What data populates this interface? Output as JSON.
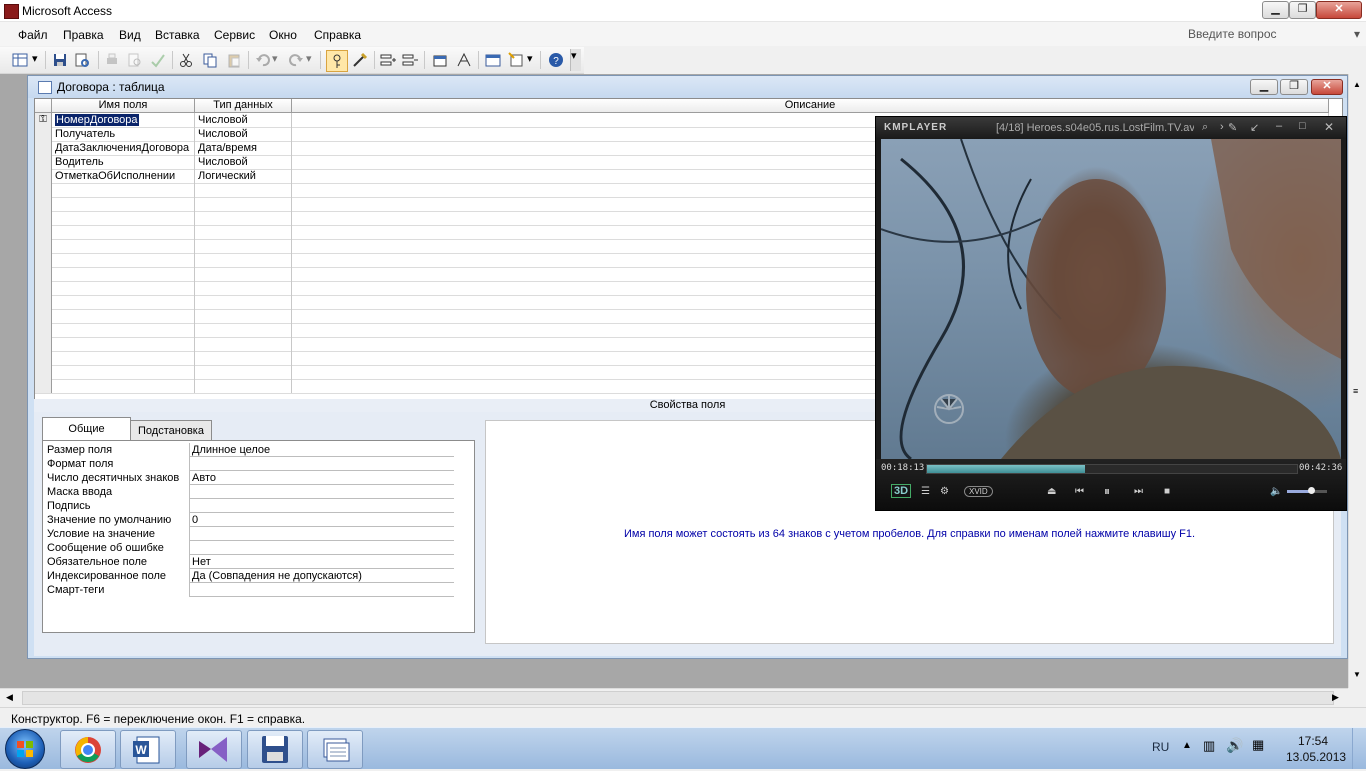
{
  "app": {
    "title": "Microsoft Access"
  },
  "menu": [
    "Файл",
    "Правка",
    "Вид",
    "Вставка",
    "Сервис",
    "Окно",
    "Справка"
  ],
  "ask_placeholder": "Введите вопрос",
  "toolbar_icons": [
    "view-icon",
    "save-icon",
    "table-props-icon",
    "print-icon",
    "print-preview-icon",
    "spelling-icon",
    "cut-icon",
    "copy-icon",
    "paste-icon",
    "undo-icon",
    "redo-icon",
    "primary-key-icon",
    "builder-icon",
    "insert-rows-icon",
    "delete-rows-icon",
    "properties-icon",
    "indexes-icon",
    "database-window-icon",
    "new-object-icon",
    "help-icon"
  ],
  "table_window": {
    "title": "Договора : таблица",
    "columns": [
      "Имя поля",
      "Тип данных",
      "Описание"
    ],
    "rows": [
      {
        "name": "НомерДоговора",
        "type": "Числовой",
        "key": true
      },
      {
        "name": "Получатель",
        "type": "Числовой",
        "key": false
      },
      {
        "name": "ДатаЗаключенияДоговора",
        "type": "Дата/время",
        "key": false
      },
      {
        "name": "Водитель",
        "type": "Числовой",
        "key": false
      },
      {
        "name": "ОтметкаОбИсполнении",
        "type": "Логический",
        "key": false
      }
    ],
    "props_title": "Свойства поля",
    "tabs": [
      "Общие",
      "Подстановка"
    ],
    "active_tab": "Общие",
    "properties": [
      {
        "label": "Размер поля",
        "value": "Длинное целое"
      },
      {
        "label": "Формат поля",
        "value": ""
      },
      {
        "label": "Число десятичных знаков",
        "value": "Авто"
      },
      {
        "label": "Маска ввода",
        "value": ""
      },
      {
        "label": "Подпись",
        "value": ""
      },
      {
        "label": "Значение по умолчанию",
        "value": "0"
      },
      {
        "label": "Условие на значение",
        "value": ""
      },
      {
        "label": "Сообщение об ошибке",
        "value": ""
      },
      {
        "label": "Обязательное поле",
        "value": "Нет"
      },
      {
        "label": "Индексированное поле",
        "value": "Да (Совпадения не допускаются)"
      },
      {
        "label": "Смарт-теги",
        "value": ""
      }
    ],
    "help_text": "Имя поля может состоять из 64 знаков с учетом пробелов.  Для справки по именам полей нажмите клавишу F1."
  },
  "status_text": "Конструктор.  F6 = переключение окон.  F1 = справка.",
  "kmplayer": {
    "logo": "KMPLAYER",
    "title": "[4/18] Heroes.s04e05.rus.LostFilm.TV.avi",
    "time_elapsed": "00:18:13",
    "time_total": "00:42:36",
    "progress": 0.4277,
    "codec_badge": "XVID",
    "badge_3d": "3D",
    "volume": 0.6
  },
  "taskbar": {
    "apps": [
      "chrome-icon",
      "word-icon",
      "visual-studio-icon",
      "save-disk-icon",
      "windows-explorer-icon"
    ],
    "lang": "RU",
    "time": "17:54",
    "date": "13.05.2013"
  }
}
